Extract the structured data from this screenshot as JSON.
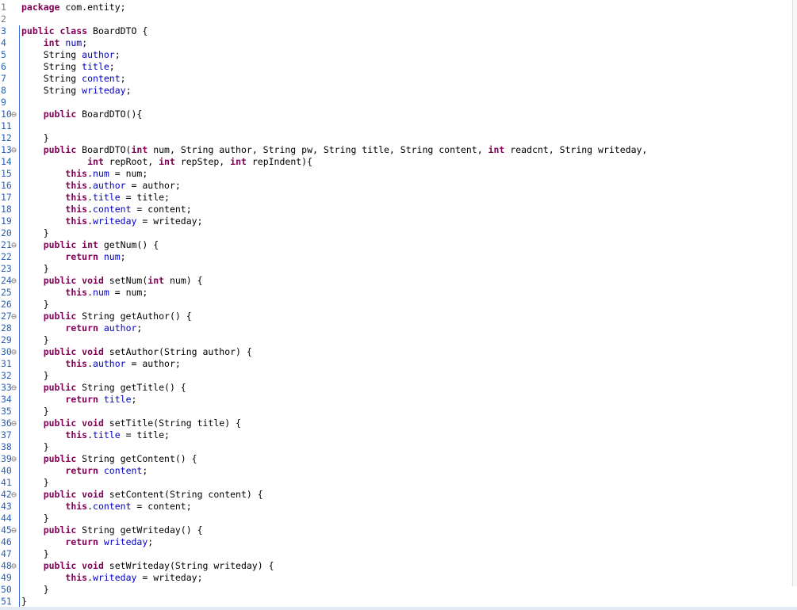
{
  "editor": {
    "lines": [
      {
        "n": "1",
        "fold": false,
        "tokens": [
          [
            "kw",
            "package"
          ],
          [
            "p",
            " com.entity;"
          ]
        ]
      },
      {
        "n": "2",
        "fold": false,
        "tokens": []
      },
      {
        "n": "3",
        "fold": false,
        "tokens": [
          [
            "kw",
            "public class"
          ],
          [
            "p",
            " BoardDTO {"
          ]
        ]
      },
      {
        "n": "4",
        "fold": false,
        "tokens": [
          [
            "p",
            "    "
          ],
          [
            "kw",
            "int"
          ],
          [
            "p",
            " "
          ],
          [
            "fd",
            "num"
          ],
          [
            "p",
            ";"
          ]
        ]
      },
      {
        "n": "5",
        "fold": false,
        "tokens": [
          [
            "p",
            "    String "
          ],
          [
            "fd",
            "author"
          ],
          [
            "p",
            ";"
          ]
        ]
      },
      {
        "n": "6",
        "fold": false,
        "tokens": [
          [
            "p",
            "    String "
          ],
          [
            "fd",
            "title"
          ],
          [
            "p",
            ";"
          ]
        ]
      },
      {
        "n": "7",
        "fold": false,
        "tokens": [
          [
            "p",
            "    String "
          ],
          [
            "fd",
            "content"
          ],
          [
            "p",
            ";"
          ]
        ]
      },
      {
        "n": "8",
        "fold": false,
        "tokens": [
          [
            "p",
            "    String "
          ],
          [
            "fd",
            "writeday"
          ],
          [
            "p",
            ";"
          ]
        ]
      },
      {
        "n": "9",
        "fold": false,
        "tokens": []
      },
      {
        "n": "10",
        "fold": true,
        "tokens": [
          [
            "p",
            "    "
          ],
          [
            "kw",
            "public"
          ],
          [
            "p",
            " BoardDTO(){"
          ]
        ]
      },
      {
        "n": "11",
        "fold": false,
        "tokens": []
      },
      {
        "n": "12",
        "fold": false,
        "tokens": [
          [
            "p",
            "    }"
          ]
        ]
      },
      {
        "n": "13",
        "fold": true,
        "tokens": [
          [
            "p",
            "    "
          ],
          [
            "kw",
            "public"
          ],
          [
            "p",
            " BoardDTO("
          ],
          [
            "kw",
            "int"
          ],
          [
            "p",
            " num, String author, String pw, String title, String content, "
          ],
          [
            "kw",
            "int"
          ],
          [
            "p",
            " readcnt, String writeday,"
          ]
        ]
      },
      {
        "n": "14",
        "fold": false,
        "tokens": [
          [
            "p",
            "            "
          ],
          [
            "kw",
            "int"
          ],
          [
            "p",
            " repRoot, "
          ],
          [
            "kw",
            "int"
          ],
          [
            "p",
            " repStep, "
          ],
          [
            "kw",
            "int"
          ],
          [
            "p",
            " repIndent){"
          ]
        ]
      },
      {
        "n": "15",
        "fold": false,
        "tokens": [
          [
            "p",
            "        "
          ],
          [
            "kw",
            "this"
          ],
          [
            "p",
            "."
          ],
          [
            "fd",
            "num"
          ],
          [
            "p",
            " = num;"
          ]
        ]
      },
      {
        "n": "16",
        "fold": false,
        "tokens": [
          [
            "p",
            "        "
          ],
          [
            "kw",
            "this"
          ],
          [
            "p",
            "."
          ],
          [
            "fd",
            "author"
          ],
          [
            "p",
            " = author;"
          ]
        ]
      },
      {
        "n": "17",
        "fold": false,
        "tokens": [
          [
            "p",
            "        "
          ],
          [
            "kw",
            "this"
          ],
          [
            "p",
            "."
          ],
          [
            "fd",
            "title"
          ],
          [
            "p",
            " = title;"
          ]
        ]
      },
      {
        "n": "18",
        "fold": false,
        "tokens": [
          [
            "p",
            "        "
          ],
          [
            "kw",
            "this"
          ],
          [
            "p",
            "."
          ],
          [
            "fd",
            "content"
          ],
          [
            "p",
            " = content;"
          ]
        ]
      },
      {
        "n": "19",
        "fold": false,
        "tokens": [
          [
            "p",
            "        "
          ],
          [
            "kw",
            "this"
          ],
          [
            "p",
            "."
          ],
          [
            "fd",
            "writeday"
          ],
          [
            "p",
            " = writeday;"
          ]
        ]
      },
      {
        "n": "20",
        "fold": false,
        "tokens": [
          [
            "p",
            "    }"
          ]
        ]
      },
      {
        "n": "21",
        "fold": true,
        "tokens": [
          [
            "p",
            "    "
          ],
          [
            "kw",
            "public int"
          ],
          [
            "p",
            " getNum() {"
          ]
        ]
      },
      {
        "n": "22",
        "fold": false,
        "tokens": [
          [
            "p",
            "        "
          ],
          [
            "kw",
            "return"
          ],
          [
            "p",
            " "
          ],
          [
            "fd",
            "num"
          ],
          [
            "p",
            ";"
          ]
        ]
      },
      {
        "n": "23",
        "fold": false,
        "tokens": [
          [
            "p",
            "    }"
          ]
        ]
      },
      {
        "n": "24",
        "fold": true,
        "tokens": [
          [
            "p",
            "    "
          ],
          [
            "kw",
            "public void"
          ],
          [
            "p",
            " setNum("
          ],
          [
            "kw",
            "int"
          ],
          [
            "p",
            " num) {"
          ]
        ]
      },
      {
        "n": "25",
        "fold": false,
        "tokens": [
          [
            "p",
            "        "
          ],
          [
            "kw",
            "this"
          ],
          [
            "p",
            "."
          ],
          [
            "fd",
            "num"
          ],
          [
            "p",
            " = num;"
          ]
        ]
      },
      {
        "n": "26",
        "fold": false,
        "tokens": [
          [
            "p",
            "    }"
          ]
        ]
      },
      {
        "n": "27",
        "fold": true,
        "tokens": [
          [
            "p",
            "    "
          ],
          [
            "kw",
            "public"
          ],
          [
            "p",
            " String getAuthor() {"
          ]
        ]
      },
      {
        "n": "28",
        "fold": false,
        "tokens": [
          [
            "p",
            "        "
          ],
          [
            "kw",
            "return"
          ],
          [
            "p",
            " "
          ],
          [
            "fd",
            "author"
          ],
          [
            "p",
            ";"
          ]
        ]
      },
      {
        "n": "29",
        "fold": false,
        "tokens": [
          [
            "p",
            "    }"
          ]
        ]
      },
      {
        "n": "30",
        "fold": true,
        "tokens": [
          [
            "p",
            "    "
          ],
          [
            "kw",
            "public void"
          ],
          [
            "p",
            " setAuthor(String author) {"
          ]
        ]
      },
      {
        "n": "31",
        "fold": false,
        "tokens": [
          [
            "p",
            "        "
          ],
          [
            "kw",
            "this"
          ],
          [
            "p",
            "."
          ],
          [
            "fd",
            "author"
          ],
          [
            "p",
            " = author;"
          ]
        ]
      },
      {
        "n": "32",
        "fold": false,
        "tokens": [
          [
            "p",
            "    }"
          ]
        ]
      },
      {
        "n": "33",
        "fold": true,
        "tokens": [
          [
            "p",
            "    "
          ],
          [
            "kw",
            "public"
          ],
          [
            "p",
            " String getTitle() {"
          ]
        ]
      },
      {
        "n": "34",
        "fold": false,
        "tokens": [
          [
            "p",
            "        "
          ],
          [
            "kw",
            "return"
          ],
          [
            "p",
            " "
          ],
          [
            "fd",
            "title"
          ],
          [
            "p",
            ";"
          ]
        ]
      },
      {
        "n": "35",
        "fold": false,
        "tokens": [
          [
            "p",
            "    }"
          ]
        ]
      },
      {
        "n": "36",
        "fold": true,
        "tokens": [
          [
            "p",
            "    "
          ],
          [
            "kw",
            "public void"
          ],
          [
            "p",
            " setTitle(String title) {"
          ]
        ]
      },
      {
        "n": "37",
        "fold": false,
        "tokens": [
          [
            "p",
            "        "
          ],
          [
            "kw",
            "this"
          ],
          [
            "p",
            "."
          ],
          [
            "fd",
            "title"
          ],
          [
            "p",
            " = title;"
          ]
        ]
      },
      {
        "n": "38",
        "fold": false,
        "tokens": [
          [
            "p",
            "    }"
          ]
        ]
      },
      {
        "n": "39",
        "fold": true,
        "tokens": [
          [
            "p",
            "    "
          ],
          [
            "kw",
            "public"
          ],
          [
            "p",
            " String getContent() {"
          ]
        ]
      },
      {
        "n": "40",
        "fold": false,
        "tokens": [
          [
            "p",
            "        "
          ],
          [
            "kw",
            "return"
          ],
          [
            "p",
            " "
          ],
          [
            "fd",
            "content"
          ],
          [
            "p",
            ";"
          ]
        ]
      },
      {
        "n": "41",
        "fold": false,
        "tokens": [
          [
            "p",
            "    }"
          ]
        ]
      },
      {
        "n": "42",
        "fold": true,
        "tokens": [
          [
            "p",
            "    "
          ],
          [
            "kw",
            "public void"
          ],
          [
            "p",
            " setContent(String content) {"
          ]
        ]
      },
      {
        "n": "43",
        "fold": false,
        "tokens": [
          [
            "p",
            "        "
          ],
          [
            "kw",
            "this"
          ],
          [
            "p",
            "."
          ],
          [
            "fd",
            "content"
          ],
          [
            "p",
            " = content;"
          ]
        ]
      },
      {
        "n": "44",
        "fold": false,
        "tokens": [
          [
            "p",
            "    }"
          ]
        ]
      },
      {
        "n": "45",
        "fold": true,
        "tokens": [
          [
            "p",
            "    "
          ],
          [
            "kw",
            "public"
          ],
          [
            "p",
            " String getWriteday() {"
          ]
        ]
      },
      {
        "n": "46",
        "fold": false,
        "tokens": [
          [
            "p",
            "        "
          ],
          [
            "kw",
            "return"
          ],
          [
            "p",
            " "
          ],
          [
            "fd",
            "writeday"
          ],
          [
            "p",
            ";"
          ]
        ]
      },
      {
        "n": "47",
        "fold": false,
        "tokens": [
          [
            "p",
            "    }"
          ]
        ]
      },
      {
        "n": "48",
        "fold": true,
        "tokens": [
          [
            "p",
            "    "
          ],
          [
            "kw",
            "public void"
          ],
          [
            "p",
            " setWriteday(String writeday) {"
          ]
        ]
      },
      {
        "n": "49",
        "fold": false,
        "tokens": [
          [
            "p",
            "        "
          ],
          [
            "kw",
            "this"
          ],
          [
            "p",
            "."
          ],
          [
            "fd",
            "writeday"
          ],
          [
            "p",
            " = writeday;"
          ]
        ]
      },
      {
        "n": "50",
        "fold": false,
        "tokens": [
          [
            "p",
            "    }"
          ]
        ]
      },
      {
        "n": "51",
        "fold": false,
        "tokens": [
          [
            "p",
            "}"
          ]
        ]
      }
    ],
    "fold_glyph": "⊖",
    "colors": {
      "keyword": "#7f0055",
      "field": "#0000c0",
      "plain": "#000000",
      "line_number": "#787878",
      "change_bar": "#3b6fd1"
    }
  }
}
